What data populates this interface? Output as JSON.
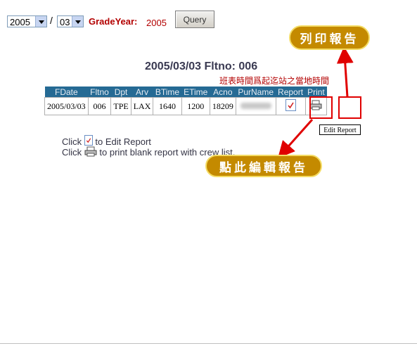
{
  "form": {
    "year": "2005",
    "month": "03",
    "separator": "/",
    "grade_year_label": "GradeYear:",
    "grade_year_value": "2005",
    "query_label": "Query"
  },
  "flight": {
    "title": "2005/03/03  Fltno: 006",
    "note": "班表時間爲起迄站之當地時間"
  },
  "table": {
    "headers": [
      "FDate",
      "Fltno",
      "Dpt",
      "Arv",
      "BTime",
      "ETime",
      "Acno",
      "PurName",
      "Report",
      "Print"
    ],
    "rows": [
      {
        "fdate": "2005/03/03",
        "fltno": "006",
        "dpt": "TPE",
        "arv": "LAX",
        "btime": "1640",
        "etime": "1200",
        "acno": "18209"
      }
    ]
  },
  "tooltip": "Edit Report",
  "callouts": {
    "print": "列印報告",
    "edit": "點此編輯報告"
  },
  "instructions": {
    "line1_prefix": "Click",
    "line1_suffix": "to Edit Report",
    "line2_prefix": "Click",
    "line2_suffix": "to print blank report with crew list."
  },
  "colors": {
    "header_bg": "#256a94",
    "accent_red": "#b30000",
    "callout_bg": "#c48a00",
    "arrow_red": "#e00000"
  }
}
